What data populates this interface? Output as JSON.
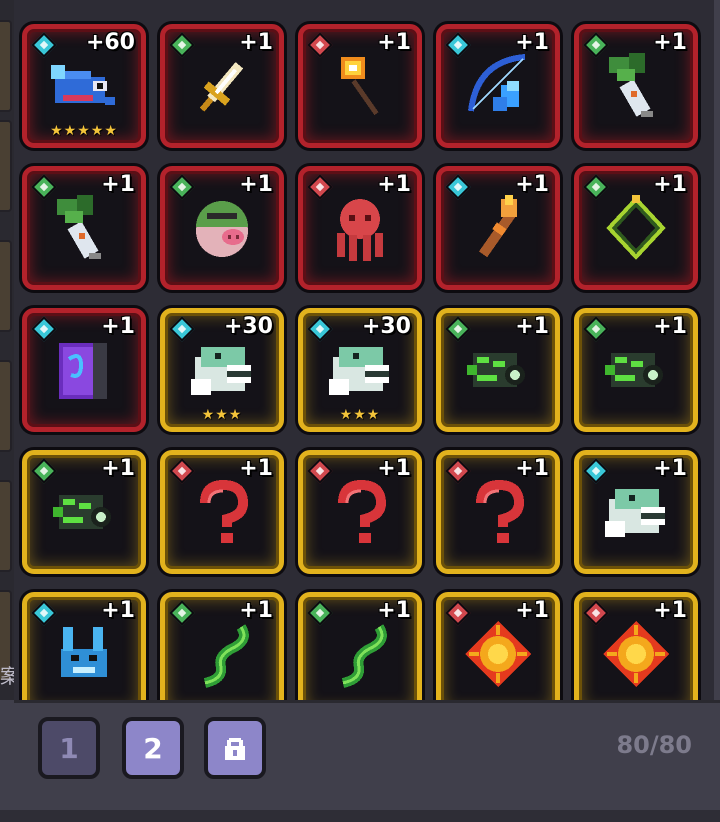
{
  "inventory": {
    "capacity_text": "80/80",
    "side_glyph": "案",
    "tabs": [
      {
        "label": "1",
        "active": false
      },
      {
        "label": "2",
        "active": true
      },
      {
        "label": "lock-icon",
        "active": false
      }
    ],
    "slots": [
      {
        "icon": "blue-shark-pet-icon",
        "rarity": "cyan",
        "frame": "red",
        "count": "+60",
        "stars": "★★★★★"
      },
      {
        "icon": "golden-sword-icon",
        "rarity": "green",
        "frame": "red",
        "count": "+1",
        "stars": ""
      },
      {
        "icon": "fire-staff-icon",
        "rarity": "red",
        "frame": "red",
        "count": "+1",
        "stars": ""
      },
      {
        "icon": "ice-bow-icon",
        "rarity": "cyan",
        "frame": "red",
        "count": "+1",
        "stars": ""
      },
      {
        "icon": "leaf-syringe-icon",
        "rarity": "green",
        "frame": "red",
        "count": "+1",
        "stars": ""
      },
      {
        "icon": "leaf-syringe-icon",
        "rarity": "green",
        "frame": "red",
        "count": "+1",
        "stars": ""
      },
      {
        "icon": "green-pig-helmet-icon",
        "rarity": "green",
        "frame": "red",
        "count": "+1",
        "stars": ""
      },
      {
        "icon": "red-octopus-icon",
        "rarity": "red",
        "frame": "red",
        "count": "+1",
        "stars": ""
      },
      {
        "icon": "flame-torch-icon",
        "rarity": "cyan",
        "frame": "red",
        "count": "+1",
        "stars": ""
      },
      {
        "icon": "green-diamond-ring-icon",
        "rarity": "green",
        "frame": "red",
        "count": "+1",
        "stars": ""
      },
      {
        "icon": "purple-spellbook-icon",
        "rarity": "cyan",
        "frame": "red",
        "count": "+1",
        "stars": ""
      },
      {
        "icon": "white-dino-skull-icon",
        "rarity": "cyan",
        "frame": "gold",
        "count": "+30",
        "stars": "★★★"
      },
      {
        "icon": "white-dino-skull-icon",
        "rarity": "cyan",
        "frame": "gold",
        "count": "+30",
        "stars": "★★★"
      },
      {
        "icon": "green-bug-fish-icon",
        "rarity": "green",
        "frame": "gold",
        "count": "+1",
        "stars": ""
      },
      {
        "icon": "green-bug-fish-icon",
        "rarity": "green",
        "frame": "gold",
        "count": "+1",
        "stars": ""
      },
      {
        "icon": "green-bug-fish-icon",
        "rarity": "green",
        "frame": "gold",
        "count": "+1",
        "stars": ""
      },
      {
        "icon": "red-question-mark-icon",
        "rarity": "red",
        "frame": "gold",
        "count": "+1",
        "stars": ""
      },
      {
        "icon": "red-question-mark-icon",
        "rarity": "red",
        "frame": "gold",
        "count": "+1",
        "stars": ""
      },
      {
        "icon": "red-question-mark-icon",
        "rarity": "red",
        "frame": "gold",
        "count": "+1",
        "stars": ""
      },
      {
        "icon": "white-dino-skull-icon",
        "rarity": "cyan",
        "frame": "gold",
        "count": "+1",
        "stars": ""
      },
      {
        "icon": "blue-dragon-pet-icon",
        "rarity": "cyan",
        "frame": "gold",
        "count": "+1",
        "stars": ""
      },
      {
        "icon": "green-vine-icon",
        "rarity": "green",
        "frame": "gold",
        "count": "+1",
        "stars": ""
      },
      {
        "icon": "green-vine-icon",
        "rarity": "green",
        "frame": "gold",
        "count": "+1",
        "stars": ""
      },
      {
        "icon": "red-sun-gem-icon",
        "rarity": "red",
        "frame": "gold",
        "count": "+1",
        "stars": ""
      },
      {
        "icon": "red-sun-gem-icon",
        "rarity": "red",
        "frame": "gold",
        "count": "+1",
        "stars": ""
      }
    ]
  },
  "colors": {
    "red_frame": "#b3222b",
    "gold_frame": "#e2b21d",
    "gem_cyan": "#39c7d8",
    "gem_green": "#49b35a",
    "gem_red": "#d2484e",
    "tab_active": "#8d86c9",
    "tab_inactive": "#4d4a68"
  }
}
